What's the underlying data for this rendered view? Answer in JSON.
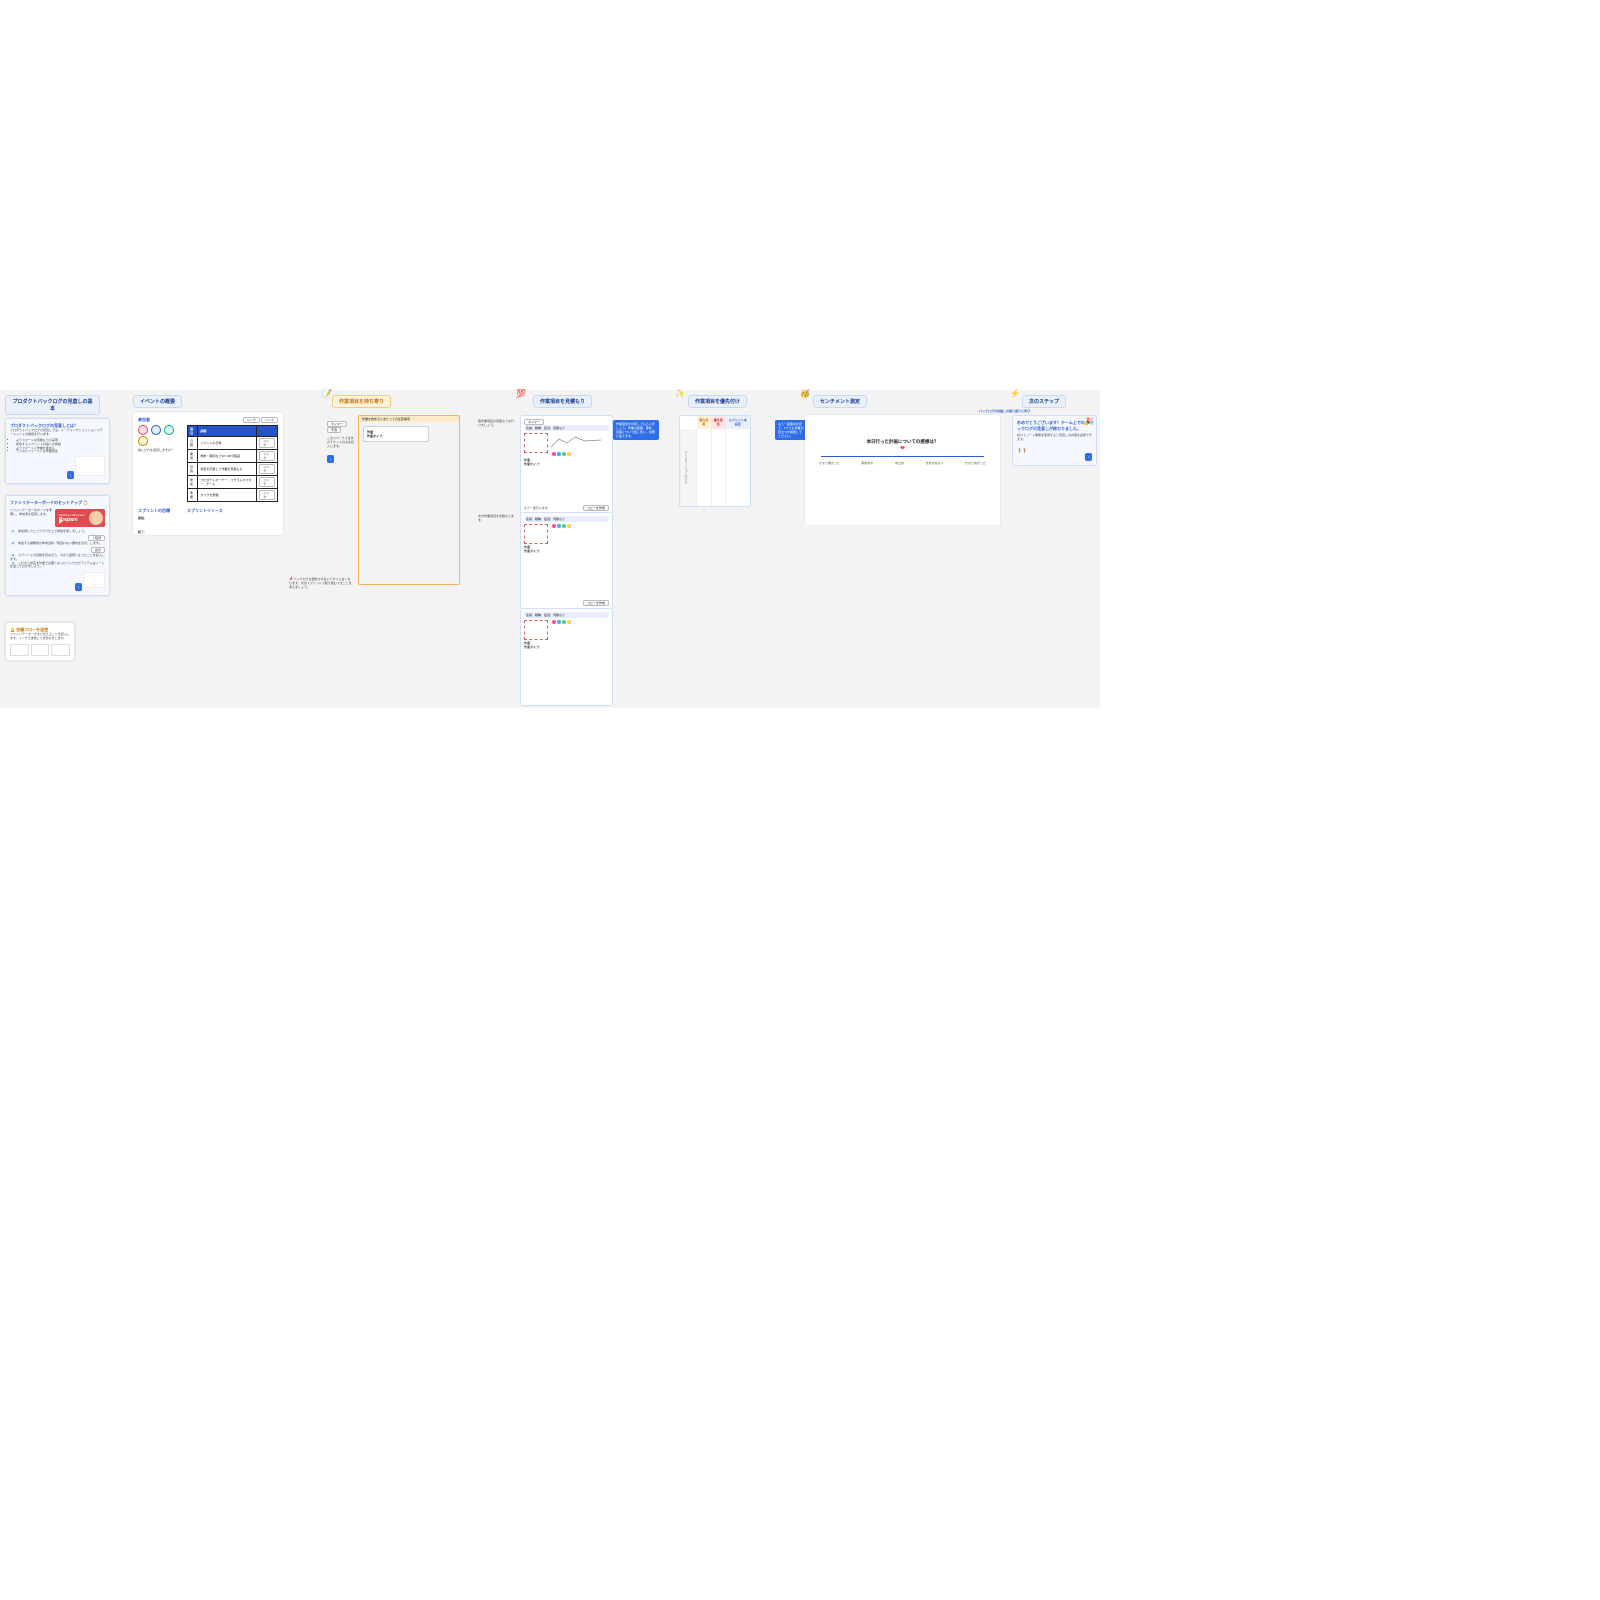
{
  "sections": {
    "s1": {
      "header": "プロダクトバックログの見直しの基本",
      "a_title": "プロダクトバックログの見直しとは？",
      "a_body1": "プロダクトバックログの見直しでは、ミーティングとミッションステートメントの確認を行います。",
      "a_bullets": [
        "よりスマートな見積もりの実現",
        "成功するスプリント計画への貢献",
        "よりスマートに作業を進める",
        "デジタルファーストな作業環境"
      ],
      "b_title": "ファシリテーターボードのセットアップ",
      "b_red1": "Backlog refinement",
      "b_red2": "Prepare",
      "steps": [
        "参加者にウェブブラウザ上で参加を促しましょう。",
        "参加する被験者の参考資料「間違わない要約を表示」します。",
        "スプリントの目標を見ながら、今から話題となったことを記入します。",
        "これから見直す作業で必要となったバックログアイテムはノートを貼っておきましょう。"
      ],
      "invite_btn": "+ 招待",
      "c_title": "会議フローを送信",
      "c_body": "ファシリテーターがまだ伝えることを記入します。リンクで送信してお知らせします。"
    },
    "s2": {
      "header": "イベントの概要",
      "sub1": "参加者",
      "avatars": [
        "A",
        "B",
        "C",
        "D"
      ],
      "hint": "他にだれを招待しますか？",
      "table_head": [
        "項目",
        "詳細"
      ],
      "rows": [
        [
          "日時",
          "イベントの日時"
        ],
        [
          "期間",
          "端末・時間など30〜60分程度"
        ],
        [
          "目的",
          "項目を定義して作業を見積もる"
        ],
        [
          "参加",
          "プロダクトオーナー、スクラムマスター、チーム"
        ],
        [
          "準備",
          "タスクを整理"
        ]
      ],
      "link_btn": "リンク",
      "goal_title": "スプリントの目標",
      "res_title": "スプリントリソース",
      "start": "開始：",
      "end": "終了："
    },
    "s3": {
      "header": "作業項目を持ち寄り",
      "side_note": "このスペースでは次のチケットのみを記入します。",
      "top_note": "作業を始めるにあたっての注意事項",
      "btn1": "タイマー",
      "btn2": "予測",
      "card_label1": "作業：",
      "card_label2": "作業タイプ：",
      "low_note": "バックログは更新されないとすぐに古くなります。次のスプリントで取り組むべきことを考えましょう。"
    },
    "s4": {
      "header": "作業項目を見積もり",
      "side_note": "各作業項目の見積もりを行いましょう。",
      "timer": "タイマー",
      "card_hdr": "名前：職種：役割：見積もり",
      "label1": "作業：",
      "label2": "作業タイプ：",
      "tip1": "作業項目を共有してもらいましょう。作業の範囲、要件、目標について話し合い、質問に答えます。",
      "tip2": "もう一度行います",
      "dup": "コピーを作成"
    },
    "s5": {
      "header": "作業項目を優先付け",
      "tip": "もう一度優先を見て、1つでも作業が目立つか確認してください。",
      "cols": [
        "優先度高",
        "優先度低",
        "スプリント未設定"
      ],
      "side": "ディスカッションのメモ"
    },
    "s6": {
      "header": "センチメント測定",
      "top": "バックログの見直しの振り返りと学び",
      "q": "本日行った計画についての感想は？",
      "scale": [
        "かなり悪かった",
        "期待外れ",
        "中立的",
        "まあまあよい",
        "かなり良かった"
      ]
    },
    "s7": {
      "header": "次のステップ",
      "title": "おめでとうございます！テーム上でのバックログの見直しが終わりました。",
      "body": "続けてノート機能を使用すると見直しの内容を記録できます。"
    }
  },
  "emojis": {
    "s3": "📝",
    "s4": "💯",
    "s5": "✨",
    "s6": "🥳",
    "s7": "⚡"
  }
}
